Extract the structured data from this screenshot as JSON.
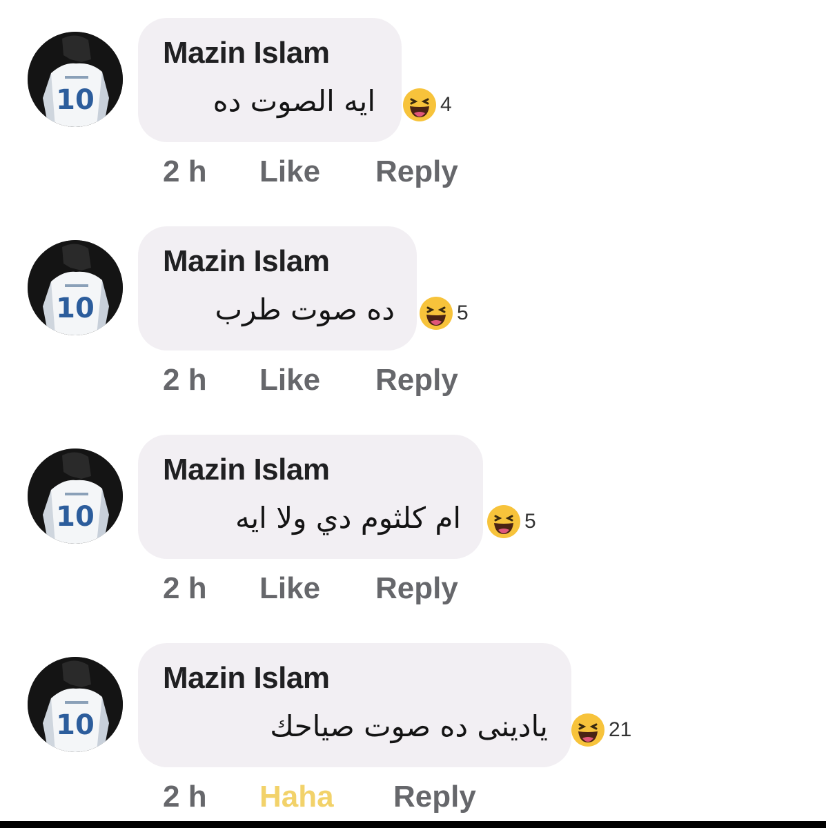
{
  "comments": [
    {
      "author": "Mazin Islam",
      "text": "ايه الصوت ده",
      "reaction_icon": "laughing-emoji",
      "reaction_count": "4",
      "time": "2 h",
      "like_label": "Like",
      "reply_label": "Reply"
    },
    {
      "author": "Mazin Islam",
      "text": "ده صوت طرب",
      "reaction_icon": "laughing-emoji",
      "reaction_count": "5",
      "time": "2 h",
      "like_label": "Like",
      "reply_label": "Reply"
    },
    {
      "author": "Mazin Islam",
      "text": "ام كلثوم دي ولا ايه",
      "reaction_icon": "laughing-emoji",
      "reaction_count": "5",
      "time": "2 h",
      "like_label": "Like",
      "reply_label": "Reply"
    },
    {
      "author": "Mazin Islam",
      "text": "يادينى ده صوت صياحك",
      "reaction_icon": "laughing-emoji",
      "reaction_count": "21",
      "time": "2 h",
      "like_label": "Haha",
      "like_color": "#f2d26a",
      "reply_label": "Reply"
    }
  ],
  "colors": {
    "bubble": "#f2eff3",
    "meta_text": "#66676b",
    "haha_active": "#f2d26a",
    "avatar_bg": "#141414"
  }
}
